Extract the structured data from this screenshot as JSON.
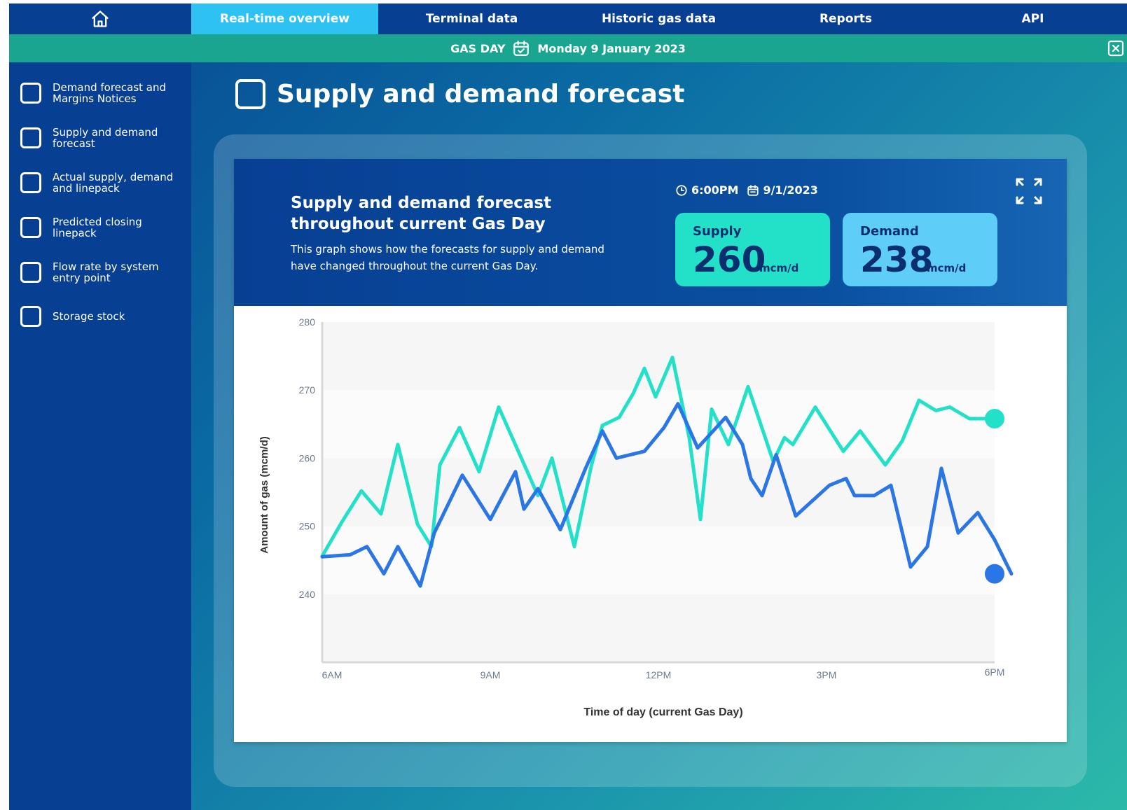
{
  "nav": {
    "tabs": [
      {
        "label": "Real-time overview",
        "active": true
      },
      {
        "label": "Terminal data"
      },
      {
        "label": "Historic gas data"
      },
      {
        "label": "Reports"
      },
      {
        "label": "API"
      }
    ]
  },
  "gas_day": {
    "label": "GAS DAY",
    "date": "Monday 9 January 2023"
  },
  "sidebar": {
    "items": [
      {
        "label": "Demand forecast and Margins Notices"
      },
      {
        "label": "Supply and demand forecast"
      },
      {
        "label": "Actual supply, demand and linepack"
      },
      {
        "label": "Predicted closing linepack"
      },
      {
        "label": "Flow rate by system entry point"
      },
      {
        "label": "Storage stock"
      }
    ]
  },
  "page": {
    "title": "Supply and demand forecast"
  },
  "card": {
    "title": "Supply and demand forecast throughout current Gas Day",
    "description": "This graph shows how the forecasts for supply and demand have changed throughout the current Gas Day.",
    "time": "6:00PM",
    "date": "9/1/2023",
    "supply": {
      "label": "Supply",
      "value": "260",
      "unit": "mcm/d"
    },
    "demand": {
      "label": "Demand",
      "value": "238",
      "unit": "mcm/d"
    }
  },
  "colors": {
    "supply": "#23e0c9",
    "demand": "#2a76e6",
    "nav": "#073f93",
    "gas_day_bar": "#1aa590",
    "active_tab": "#2ec2f2"
  },
  "chart_data": {
    "type": "line",
    "xlabel": "Time of day (current Gas Day)",
    "ylabel": "Amount of gas (mcm/d)",
    "x_ticks": [
      {
        "label": "6AM",
        "hour": 6
      },
      {
        "label": "9AM",
        "hour": 9
      },
      {
        "label": "12PM",
        "hour": 12
      },
      {
        "label": "3PM",
        "hour": 15
      },
      {
        "label": "6PM",
        "hour": 18
      }
    ],
    "xlim": [
      6,
      18
    ],
    "y_ticks": [
      240,
      250,
      260,
      270,
      280
    ],
    "ylim": [
      230,
      280
    ],
    "series": [
      {
        "key": "supply",
        "color": "#23e0c9",
        "points": [
          [
            6.0,
            245.6
          ],
          [
            6.35,
            250.6
          ],
          [
            6.7,
            255.2
          ],
          [
            7.05,
            251.8
          ],
          [
            7.35,
            262.0
          ],
          [
            7.7,
            250.3
          ],
          [
            7.95,
            247.0
          ],
          [
            8.1,
            259.0
          ],
          [
            8.45,
            264.5
          ],
          [
            8.8,
            258.0
          ],
          [
            9.15,
            267.5
          ],
          [
            9.5,
            261.0
          ],
          [
            9.85,
            254.5
          ],
          [
            10.1,
            260.0
          ],
          [
            10.5,
            247.0
          ],
          [
            10.8,
            258.8
          ],
          [
            11.0,
            264.8
          ],
          [
            11.3,
            266.0
          ],
          [
            11.55,
            269.5
          ],
          [
            11.75,
            273.2
          ],
          [
            11.95,
            269.0
          ],
          [
            12.25,
            274.8
          ],
          [
            12.55,
            263.0
          ],
          [
            12.75,
            251.0
          ],
          [
            12.95,
            267.2
          ],
          [
            13.25,
            262.0
          ],
          [
            13.6,
            270.5
          ],
          [
            14.05,
            259.5
          ],
          [
            14.25,
            263.0
          ],
          [
            14.4,
            262.0
          ],
          [
            14.8,
            267.5
          ],
          [
            15.3,
            261.0
          ],
          [
            15.6,
            264.0
          ],
          [
            16.05,
            259.0
          ],
          [
            16.35,
            262.5
          ],
          [
            16.65,
            268.5
          ],
          [
            16.95,
            267.0
          ],
          [
            17.2,
            267.5
          ],
          [
            17.55,
            265.8
          ],
          [
            18.0,
            265.8
          ]
        ]
      },
      {
        "key": "demand",
        "color": "#2a76e6",
        "points": [
          [
            6.0,
            245.5
          ],
          [
            6.5,
            245.8
          ],
          [
            6.8,
            247.0
          ],
          [
            7.1,
            243.0
          ],
          [
            7.35,
            247.0
          ],
          [
            7.75,
            241.2
          ],
          [
            8.0,
            249.0
          ],
          [
            8.5,
            257.5
          ],
          [
            9.0,
            251.0
          ],
          [
            9.45,
            258.0
          ],
          [
            9.6,
            252.5
          ],
          [
            9.85,
            255.5
          ],
          [
            10.25,
            249.5
          ],
          [
            10.7,
            258.5
          ],
          [
            11.0,
            264.0
          ],
          [
            11.25,
            260.0
          ],
          [
            11.75,
            261.0
          ],
          [
            12.1,
            264.5
          ],
          [
            12.35,
            268.0
          ],
          [
            12.7,
            261.5
          ],
          [
            13.2,
            266.0
          ],
          [
            13.5,
            262.0
          ],
          [
            13.65,
            257.0
          ],
          [
            13.85,
            254.5
          ],
          [
            14.1,
            260.5
          ],
          [
            14.45,
            251.5
          ],
          [
            15.05,
            256.0
          ],
          [
            15.35,
            257.0
          ],
          [
            15.5,
            254.5
          ],
          [
            15.85,
            254.5
          ],
          [
            16.15,
            256.0
          ],
          [
            16.5,
            244.0
          ],
          [
            16.8,
            247.0
          ],
          [
            17.05,
            258.5
          ],
          [
            17.35,
            249.0
          ],
          [
            17.7,
            252.0
          ],
          [
            18.0,
            248.0
          ],
          [
            18.3,
            243.0
          ]
        ]
      }
    ],
    "grid": "alternating horizontal bands",
    "legend": "none"
  }
}
